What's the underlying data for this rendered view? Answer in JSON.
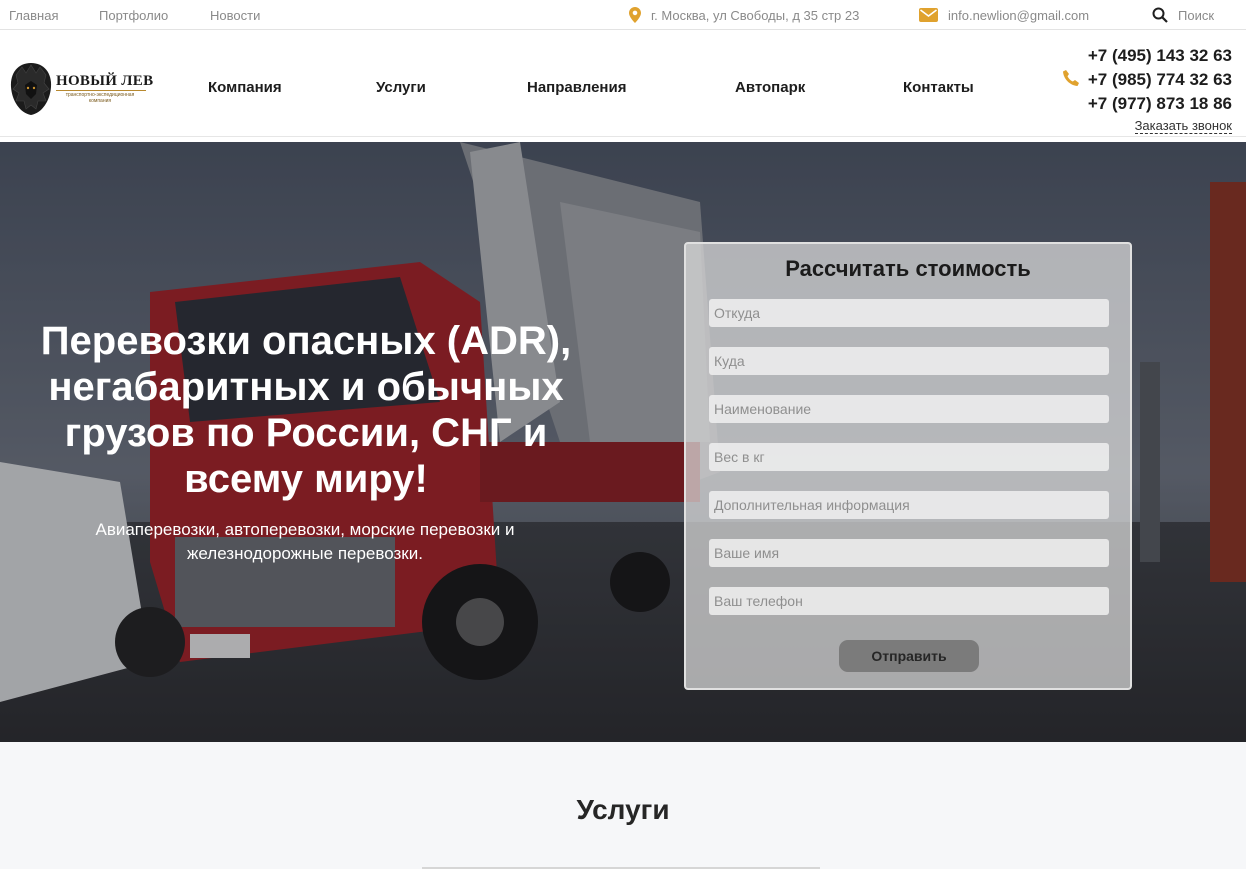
{
  "topbar": {
    "links": [
      "Главная",
      "Портфолио",
      "Новости"
    ],
    "address": "г. Москва, ул Свободы, д 35 стр 23",
    "email": "info.newlion@gmail.com",
    "search_label": "Поиск",
    "accent_color": "#e0a22e"
  },
  "logo": {
    "title": "НОВЫЙ ЛЕВ",
    "subtitle": "транспортно-экспедиционная компания"
  },
  "nav": {
    "items": [
      "Компания",
      "Услуги",
      "Направления",
      "Автопарк",
      "Контакты"
    ]
  },
  "contacts": {
    "phones": [
      "+7 (495) 143 32 63",
      "+7 (985) 774 32 63",
      "+7 (977) 873 18 86"
    ],
    "callback_label": "Заказать звонок"
  },
  "hero": {
    "title": "Перевозки опасных (ADR), негабаритных и обычных грузов по России, СНГ и всему миру!",
    "subtitle": "Авиаперевозки, автоперевозки, морские перевозки и железнодорожные перевозки."
  },
  "calc_form": {
    "title": "Рассчитать стоимость",
    "fields": [
      {
        "placeholder": "Откуда",
        "value": ""
      },
      {
        "placeholder": "Куда",
        "value": ""
      },
      {
        "placeholder": "Наименование",
        "value": ""
      },
      {
        "placeholder": "Вес в кг",
        "value": ""
      },
      {
        "placeholder": "Дополнительная информация",
        "value": ""
      },
      {
        "placeholder": "Ваше имя",
        "value": ""
      },
      {
        "placeholder": "Ваш телефон",
        "value": ""
      }
    ],
    "submit_label": "Отправить"
  },
  "services": {
    "title": "Услуги"
  }
}
